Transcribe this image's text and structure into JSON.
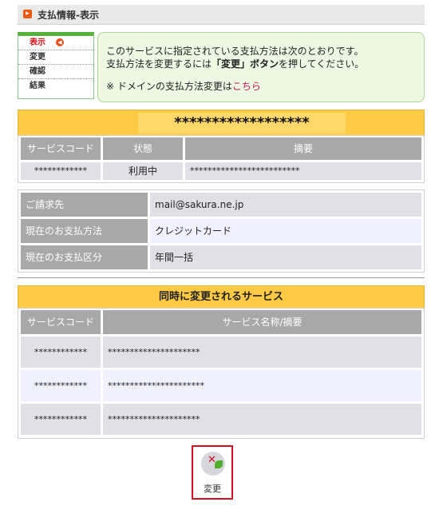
{
  "header": {
    "title": "支払情報-表示"
  },
  "steps": [
    {
      "label": "表示",
      "active": true
    },
    {
      "label": "変更",
      "active": false
    },
    {
      "label": "確認",
      "active": false
    },
    {
      "label": "結果",
      "active": false
    }
  ],
  "info": {
    "line1": "このサービスに指定されている支払方法は次のとおりです。",
    "line2_pre": "支払方法を変更するには",
    "line2_bold": "「変更」ボタン",
    "line2_post": "を押してください。",
    "line3_pre": "※ ドメインの支払方法変更は",
    "line3_link": "こちら"
  },
  "service": {
    "title": "******************",
    "headers": [
      "サービスコード",
      "状態",
      "摘要"
    ],
    "row": [
      "************",
      "利用中",
      "*************************"
    ]
  },
  "billing": {
    "rows": [
      {
        "label": "ご請求先",
        "value": "mail@sakura.ne.jp"
      },
      {
        "label": "現在のお支払方法",
        "value": "クレジットカード"
      },
      {
        "label": "現在のお支払区分",
        "value": "年間一括"
      }
    ]
  },
  "related": {
    "title": "同時に変更されるサービス",
    "headers": [
      "サービスコード",
      "サービス名称/摘要"
    ],
    "rows": [
      [
        "************",
        "*********************"
      ],
      [
        "************",
        "**********************"
      ],
      [
        "************",
        "*********************"
      ]
    ]
  },
  "change_button": {
    "label": "変更"
  }
}
